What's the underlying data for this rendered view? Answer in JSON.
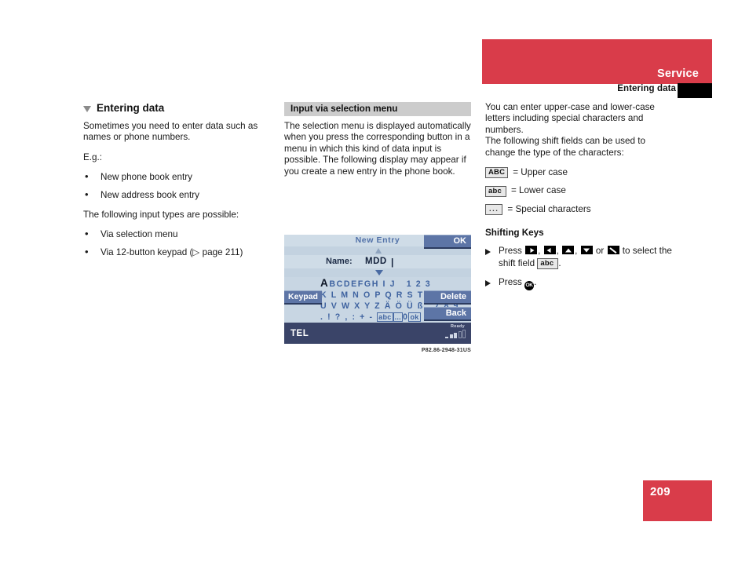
{
  "header": {
    "section_title": "Service",
    "running_head": "Entering data"
  },
  "left_column": {
    "heading": "Entering data",
    "intro": "Sometimes you need to enter data such as names or phone numbers.",
    "eg_label": "E.g.:",
    "examples": [
      "New phone book entry",
      "New address book entry"
    ],
    "input_types_intro": "The following input types are possible:",
    "input_types": [
      "Via selection menu",
      "Via 12-button keypad (▷ page 211)"
    ]
  },
  "middle_column": {
    "subhead": "Input via selection menu",
    "body": "The selection menu is displayed automatically when you press the corresponding button in a menu in which this kind of data input is possible. The following display may appear if you create a new entry in the phone book.",
    "figure_caption": "P82.86-2948-31US"
  },
  "device_screen": {
    "title": "New Entry",
    "ok_button": "OK",
    "field_label": "Name:",
    "field_value": "MDD",
    "caret": "|",
    "char_rows": [
      "ABCDEFGH I J    1 2 3",
      "K L M N O P Q R S T – 4 5 6",
      "U V W X Y Z Ä Ö Ü ß    7 8 9",
      ". ! ? , : + -"
    ],
    "row4_boxes": [
      "abc",
      "...",
      "0",
      "ok"
    ],
    "keypad_button": "Keypad",
    "delete_button": "Delete",
    "back_button": "Back",
    "status_mode": "TEL",
    "status_ready": "Ready"
  },
  "right_column": {
    "intro": "You can enter upper-case and lower-case letters including special characters and numbers.",
    "intro2": "The following shift fields can be used to change the type of the characters:",
    "shift_fields": [
      {
        "key": "ABC",
        "desc": "= Upper case"
      },
      {
        "key": "abc",
        "desc": "= Lower case"
      },
      {
        "key": "...",
        "desc": "= Special characters"
      }
    ],
    "shifting_heading": "Shifting Keys",
    "step1_pre": "Press",
    "step1_sep": ",",
    "step1_or": "or",
    "step1_to": "to",
    "step1_post": "select the shift field",
    "step1_field": "abc",
    "step1_period": ".",
    "step2_pre": "Press",
    "step2_key": "OK",
    "step2_post": "."
  },
  "footer": {
    "page_number": "209"
  },
  "colors": {
    "brand_red": "#d93c4a",
    "screen_blue": "#c8d6e3",
    "button_blue": "#5d75a6",
    "status_navy": "#3a4468",
    "gray_head": "#cccccc"
  }
}
